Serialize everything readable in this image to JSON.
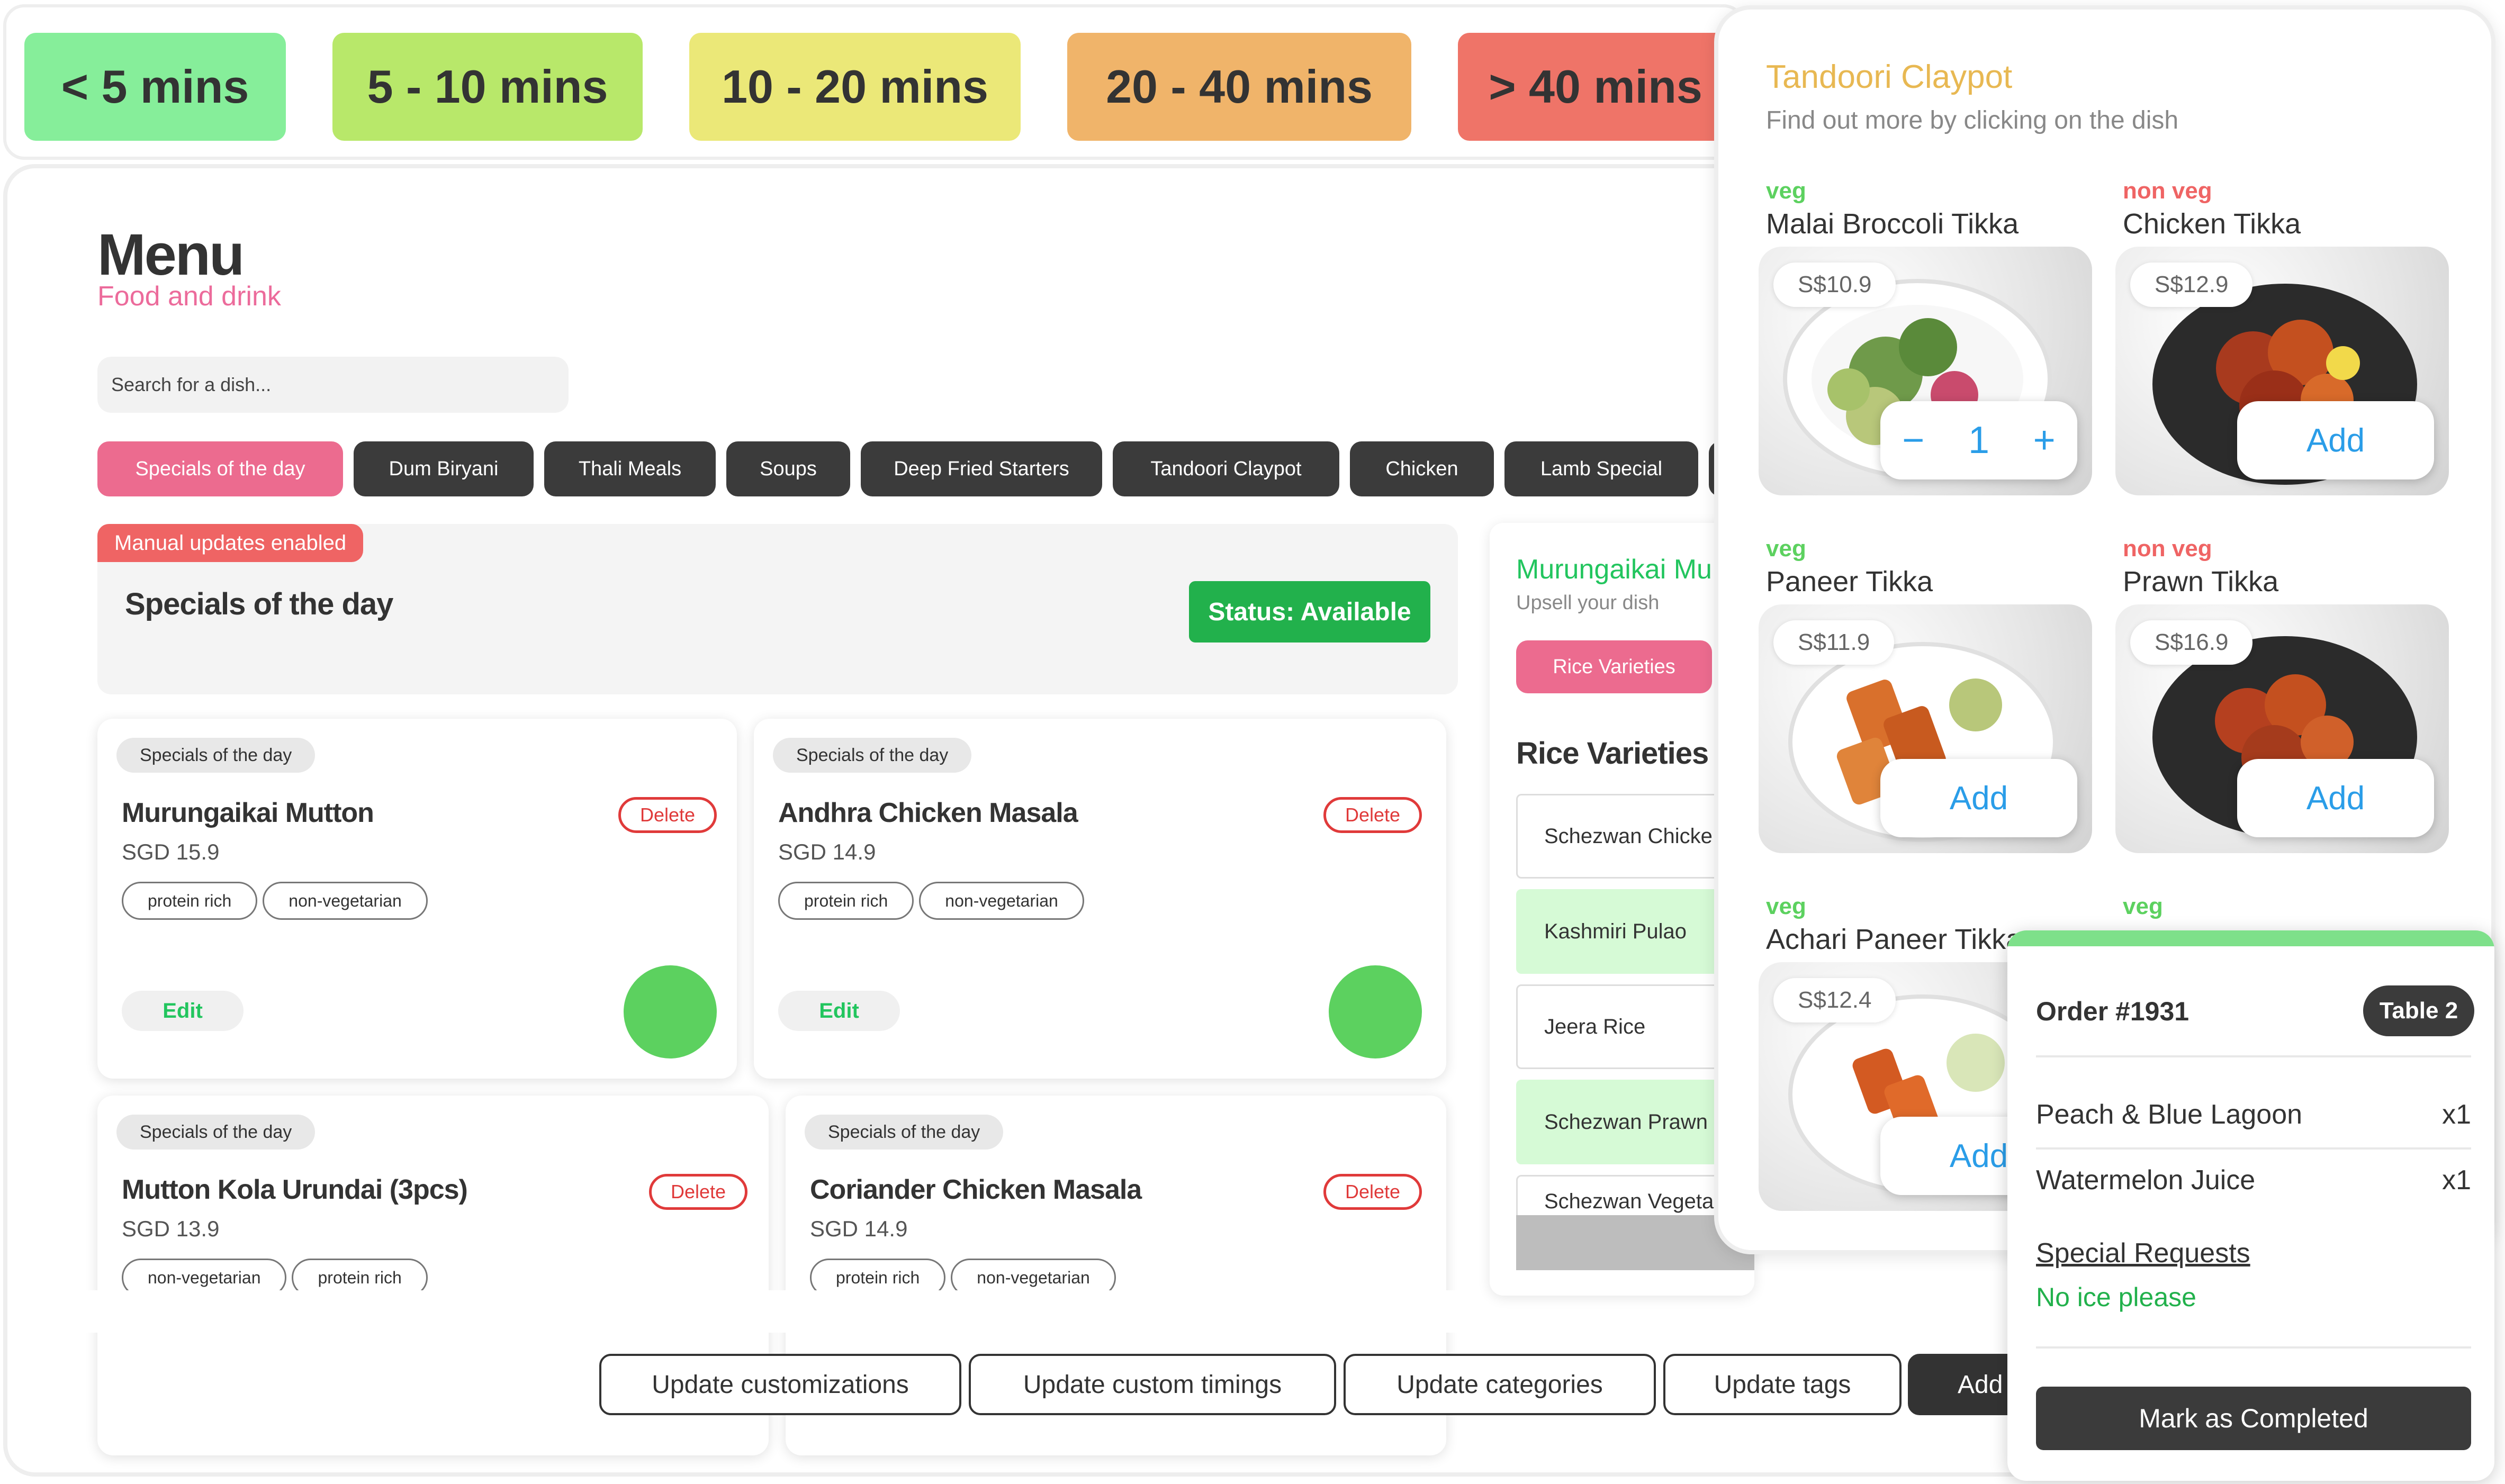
{
  "timing_bar": {
    "pills": [
      {
        "label": "< 5 mins",
        "color": "#86ee9a"
      },
      {
        "label": "5 - 10 mins",
        "color": "#b8e86a"
      },
      {
        "label": "10 - 20 mins",
        "color": "#ebe878"
      },
      {
        "label": "20 - 40 mins",
        "color": "#f0b46a"
      },
      {
        "label": "> 40 mins",
        "color": "#ef7468"
      }
    ]
  },
  "menu": {
    "title": "Menu",
    "subtitle": "Food and drink",
    "search_placeholder": "Search for a dish...",
    "categories": [
      "Specials of the day",
      "Dum Biryani",
      "Thali Meals",
      "Soups",
      "Deep Fried Starters",
      "Tandoori Claypot",
      "Chicken",
      "Lamb Special"
    ],
    "active_category": "Specials of the day",
    "header": {
      "badge": "Manual updates enabled",
      "title": "Specials of the day",
      "status": "Status: Available"
    },
    "dishes": [
      {
        "category": "Specials of the day",
        "name": "Murungaikai Mutton",
        "price": "SGD 15.9",
        "tags": [
          "protein rich",
          "non-vegetarian"
        ],
        "delete_label": "Delete",
        "edit_label": "Edit"
      },
      {
        "category": "Specials of the day",
        "name": "Andhra Chicken Masala",
        "price": "SGD 14.9",
        "tags": [
          "protein rich",
          "non-vegetarian"
        ],
        "delete_label": "Delete",
        "edit_label": "Edit"
      },
      {
        "category": "Specials of the day",
        "name": "Mutton Kola Urundai (3pcs)",
        "price": "SGD 13.9",
        "tags": [
          "non-vegetarian",
          "protein rich"
        ],
        "delete_label": "Delete"
      },
      {
        "category": "Specials of the day",
        "name": "Coriander Chicken Masala",
        "price": "SGD 14.9",
        "tags": [
          "protein rich",
          "non-vegetarian"
        ],
        "delete_label": "Delete"
      }
    ],
    "status_color": "#5cd15f"
  },
  "upsell": {
    "title": "Murungaikai Mu",
    "subtitle": "Upsell your dish",
    "tab_label": "Rice Varieties",
    "section_title": "Rice Varieties",
    "items": [
      {
        "label": "Schezwan Chicke",
        "selected": false
      },
      {
        "label": "Kashmiri Pulao",
        "selected": true
      },
      {
        "label": "Jeera Rice",
        "selected": false
      },
      {
        "label": "Schezwan Prawn",
        "selected": true
      },
      {
        "label": "Schezwan Vegeta",
        "selected": false
      }
    ]
  },
  "actions": {
    "buttons": [
      "Update customizations",
      "Update custom timings",
      "Update categories",
      "Update tags"
    ],
    "add_label": "Add"
  },
  "tandoori": {
    "title": "Tandoori Claypot",
    "subtitle": "Find out more by clicking on the dish",
    "add_label": "Add",
    "dishes": [
      {
        "type": "veg",
        "name": "Malai Broccoli Tikka",
        "price": "S$10.9",
        "quantity": "1",
        "stepper_minus": "−",
        "stepper_plus": "+"
      },
      {
        "type": "non veg",
        "name": "Chicken Tikka",
        "price": "S$12.9"
      },
      {
        "type": "veg",
        "name": "Paneer Tikka",
        "price": "S$11.9"
      },
      {
        "type": "non veg",
        "name": "Prawn Tikka",
        "price": "S$16.9"
      },
      {
        "type": "veg",
        "name": "Achari Paneer Tikka",
        "price": "S$12.4"
      },
      {
        "type": "veg",
        "name": "",
        "price": ""
      }
    ]
  },
  "order": {
    "number": "Order #1931",
    "table": "Table 2",
    "items": [
      {
        "name": "Peach & Blue Lagoon",
        "qty": "x1"
      },
      {
        "name": "Watermelon Juice",
        "qty": "x1"
      }
    ],
    "special_requests_label": "Special Requests",
    "special_requests": "No ice please",
    "complete_label": "Mark as Completed"
  }
}
